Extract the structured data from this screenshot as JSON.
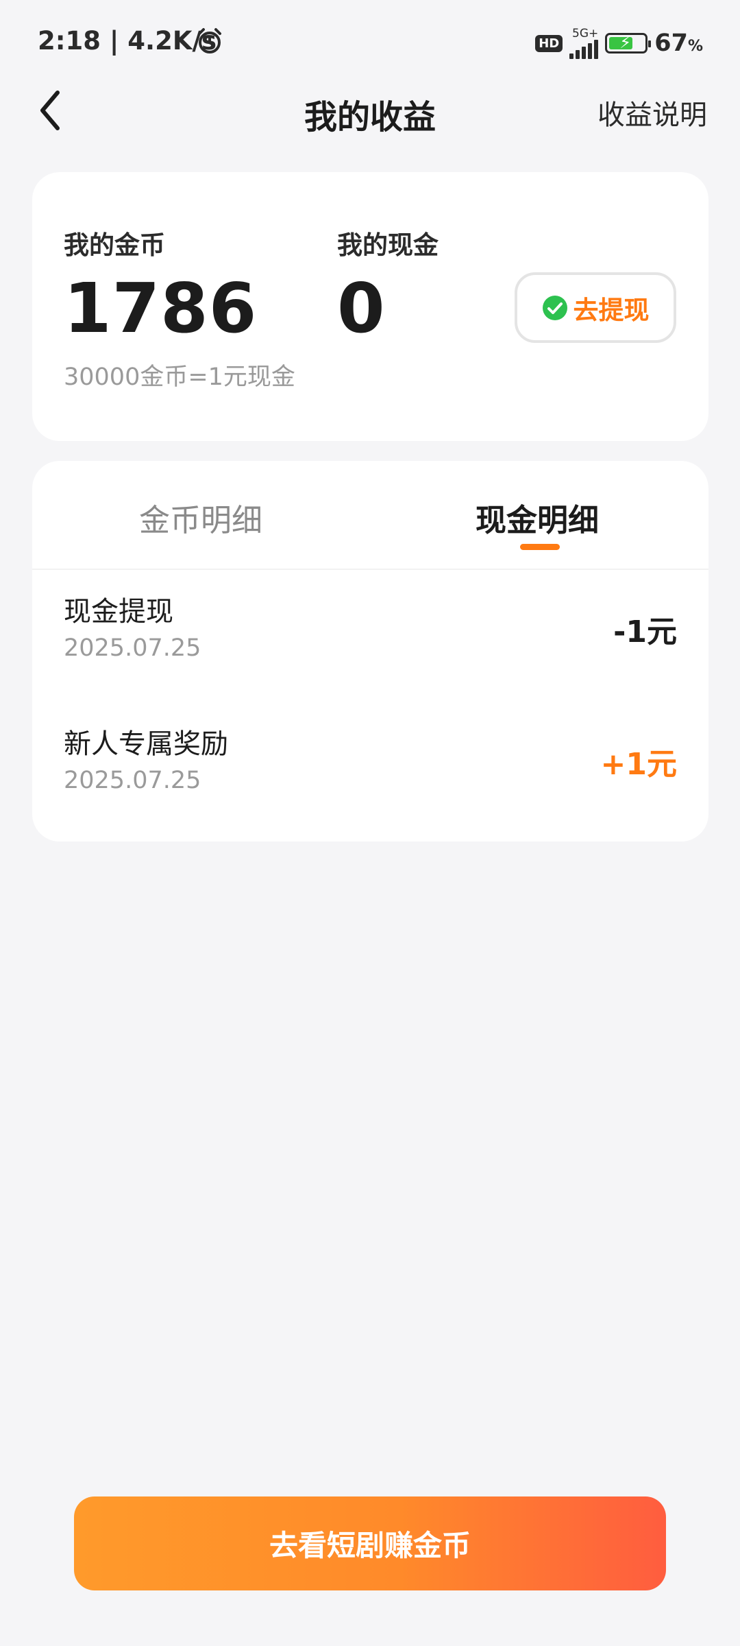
{
  "status_bar": {
    "time": "2:18 | 4.2K/s",
    "hd": "HD",
    "network": "5G+",
    "battery_percent": "67",
    "percent_sign": "%",
    "battery_level": 0.67
  },
  "nav": {
    "title": "我的收益",
    "help_link": "收益说明"
  },
  "balance": {
    "coins_label": "我的金币",
    "coins_value": "1786",
    "cash_label": "我的现金",
    "cash_value": "0",
    "rate_text": "30000金币=1元现金",
    "withdraw_label": "去提现"
  },
  "tabs": {
    "coins": "金币明细",
    "cash": "现金明细",
    "active": "cash"
  },
  "records": [
    {
      "title": "现金提现",
      "date": "2025.07.25",
      "amount": "-1元",
      "color": "#1c1c1c"
    },
    {
      "title": "新人专属奖励",
      "date": "2025.07.25",
      "amount": "+1元",
      "color": "#ff7a12"
    }
  ],
  "cta": {
    "label": "去看短剧赚金币"
  },
  "colors": {
    "accent": "#ff7a12",
    "background": "#f5f5f7"
  }
}
